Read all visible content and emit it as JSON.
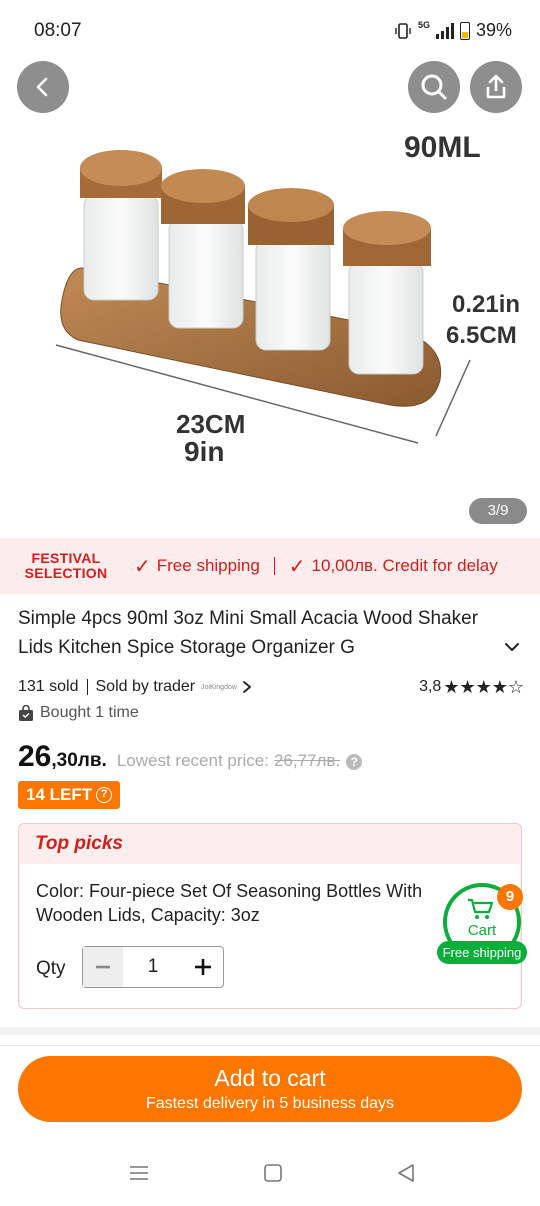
{
  "status_bar": {
    "time": "08:07",
    "network": "5G",
    "battery": "39%"
  },
  "gallery": {
    "counter": "3/9",
    "dimension_labels": {
      "capacity": "90ML",
      "height_in": "0.21in",
      "height_cm": "6.5CM",
      "width_cm": "23CM",
      "width_in": "9in"
    }
  },
  "festival": {
    "logo_line1": "FESTIVAL",
    "logo_line2": "SELECTION",
    "free_shipping": "Free shipping",
    "credit": "10,00лв. Credit for delay"
  },
  "product": {
    "title": "Simple 4pcs 90ml 3oz Mini Small Acacia Wood Shaker Lids Kitchen Spice Storage Organizer G",
    "sold": "131 sold",
    "sold_by": "Sold by trader",
    "trader_logo": "JoiKingdow",
    "rating": "3,8",
    "stars": "★★★★☆",
    "bought": "Bought 1 time",
    "price_int": "26",
    "price_dec": ",30лв.",
    "lowest_label": "Lowest recent price:",
    "lowest_value": "26,77лв.",
    "stock_badge": "14 LEFT"
  },
  "top_picks": {
    "heading": "Top picks",
    "color_line": "Color: Four-piece Set Of Seasoning Bottles With Wooden Lids, Capacity: 3oz",
    "qty_label": "Qty",
    "qty_value": "1"
  },
  "cart_float": {
    "count": "9",
    "label": "Cart",
    "shipping": "Free shipping"
  },
  "cta": {
    "label": "Add to cart",
    "sub": "Fastest delivery in 5 business days"
  },
  "colors": {
    "accent_orange": "#fb7701",
    "festival_red": "#d21e1e",
    "cart_green": "#0aae3a"
  }
}
